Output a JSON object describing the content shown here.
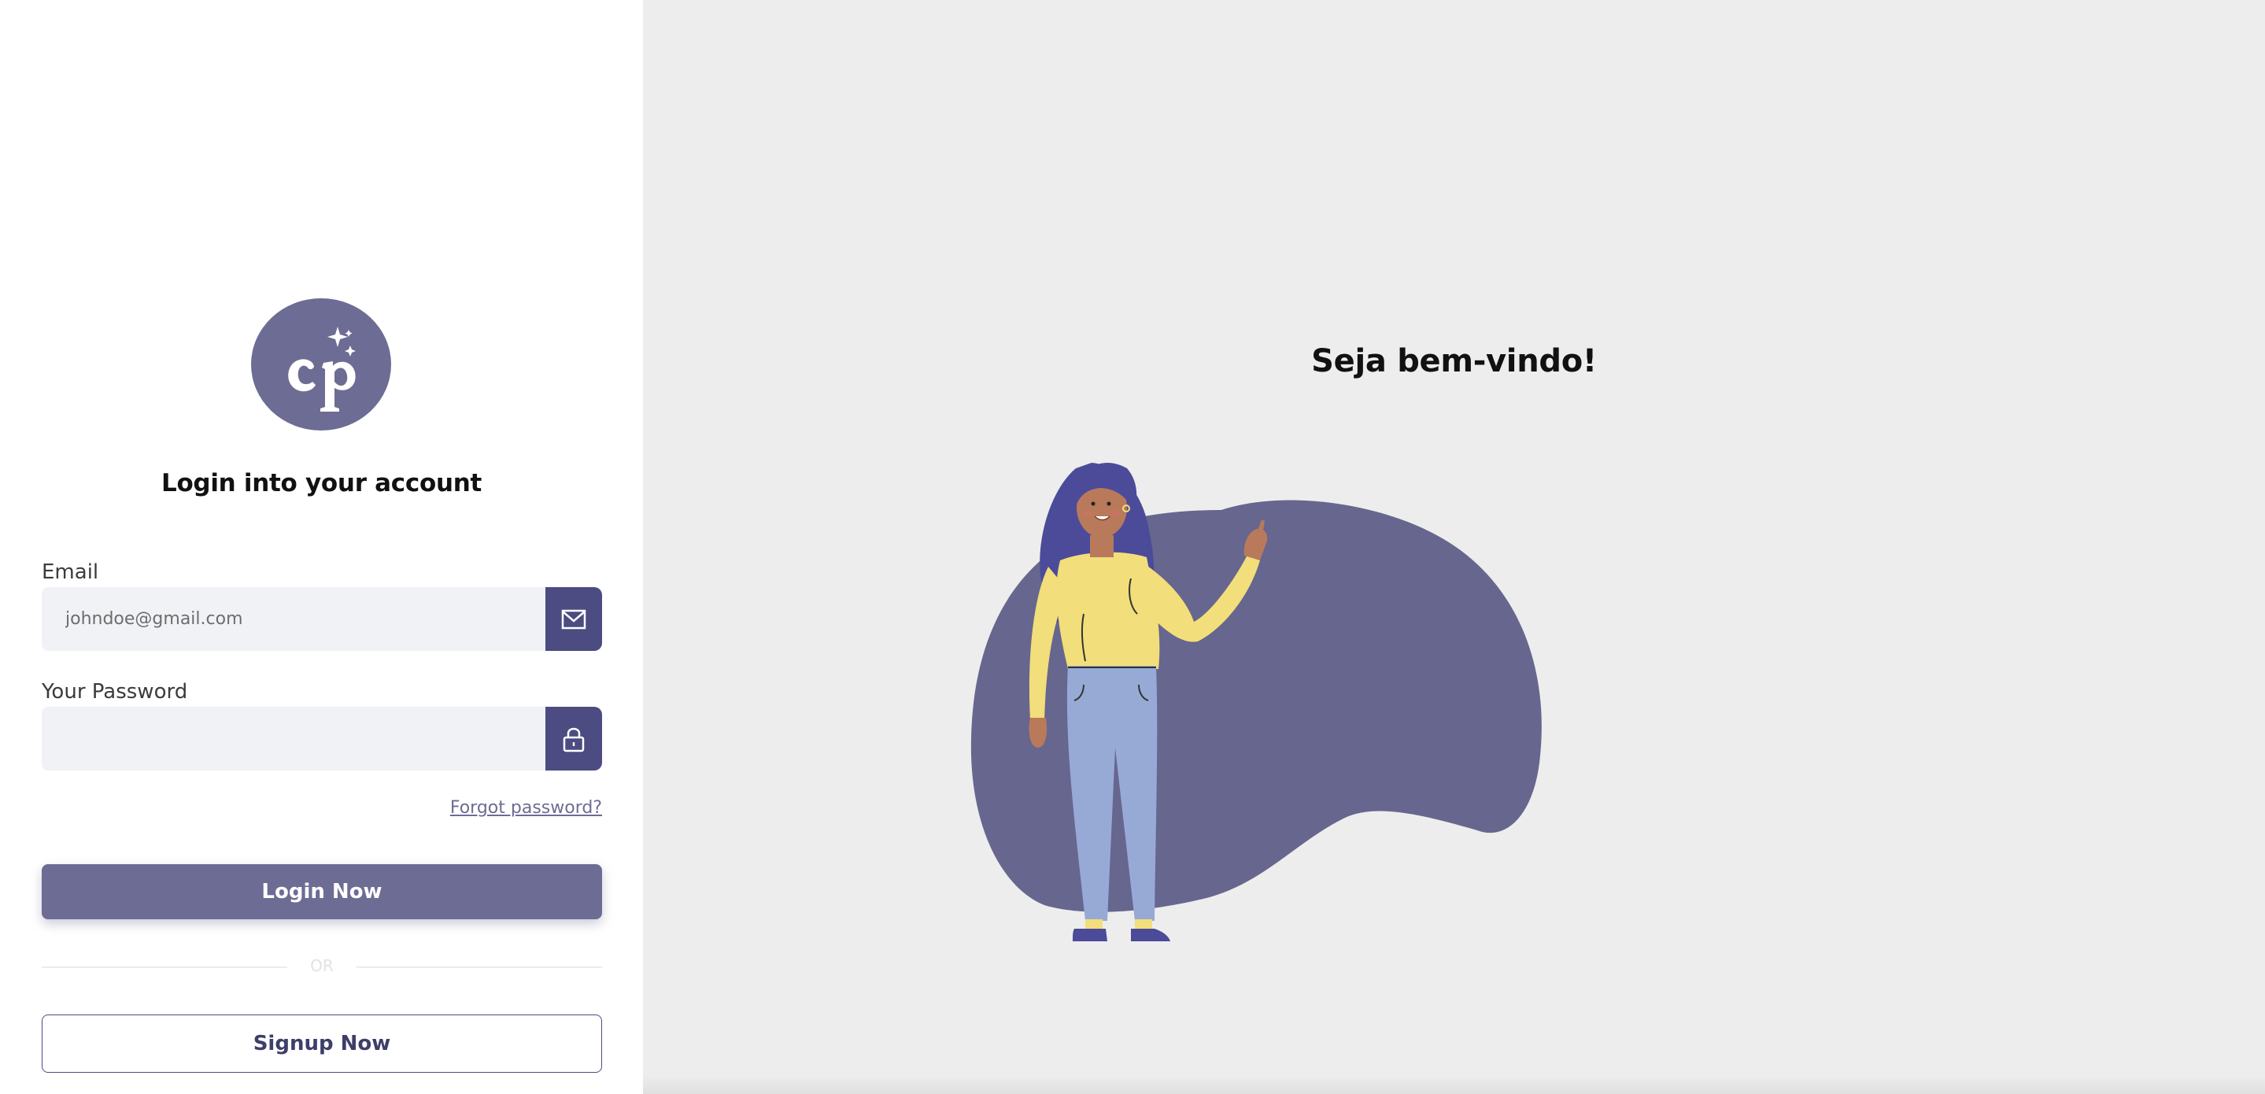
{
  "brand": {
    "logo_text": "cp",
    "logo_color": "#6d6c94",
    "accent_dark": "#4c4c82"
  },
  "login": {
    "title": "Login into your account",
    "email_label": "Email",
    "email_placeholder": "johndoe@gmail.com",
    "email_icon": "mail-icon",
    "password_label": "Your Password",
    "password_placeholder": "",
    "password_icon": "lock-icon",
    "forgot_password": "Forgot password?",
    "login_button": "Login Now",
    "divider_text": "OR",
    "signup_button": "Signup Now"
  },
  "hero": {
    "welcome": "Seja bem-vindo!",
    "illustration": "woman-waving-illustration",
    "background_color": "#ededed"
  }
}
